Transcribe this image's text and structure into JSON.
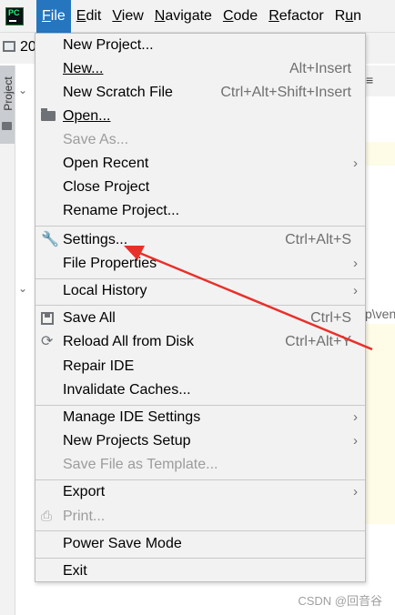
{
  "app": {
    "logo_text": "PC"
  },
  "menubar": {
    "items": [
      "File",
      "Edit",
      "View",
      "Navigate",
      "Code",
      "Refactor",
      "Run"
    ],
    "active": "File"
  },
  "background": {
    "project_name_fragment": "20",
    "side_tab_label": "Project",
    "right_fragment": "p\\ven"
  },
  "file_menu": {
    "new_project": "New Project...",
    "new": "New...",
    "new_shortcut": "Alt+Insert",
    "new_scratch": "New Scratch File",
    "new_scratch_shortcut": "Ctrl+Alt+Shift+Insert",
    "open": "Open...",
    "save_as": "Save As...",
    "open_recent": "Open Recent",
    "close_project": "Close Project",
    "rename_project": "Rename Project...",
    "settings": "Settings...",
    "settings_shortcut": "Ctrl+Alt+S",
    "file_properties": "File Properties",
    "local_history": "Local History",
    "save_all": "Save All",
    "save_all_shortcut": "Ctrl+S",
    "reload_all": "Reload All from Disk",
    "reload_all_shortcut": "Ctrl+Alt+Y",
    "repair_ide": "Repair IDE",
    "invalidate_caches": "Invalidate Caches...",
    "manage_ide_settings": "Manage IDE Settings",
    "new_projects_setup": "New Projects Setup",
    "save_file_as_template": "Save File as Template...",
    "export": "Export",
    "print": "Print...",
    "power_save_mode": "Power Save Mode",
    "exit": "Exit",
    "submenu_glyph": "›"
  },
  "icons": {
    "open": "folder-icon",
    "settings": "wrench-icon",
    "save_all": "floppy-disk-icon",
    "reload": "reload-icon",
    "print": "printer-icon"
  },
  "colors": {
    "active_menu_bg": "#2675bf",
    "annotation_arrow": "#e8302a",
    "disabled_text": "#9c9c9c"
  },
  "watermark": "CSDN @回音谷"
}
